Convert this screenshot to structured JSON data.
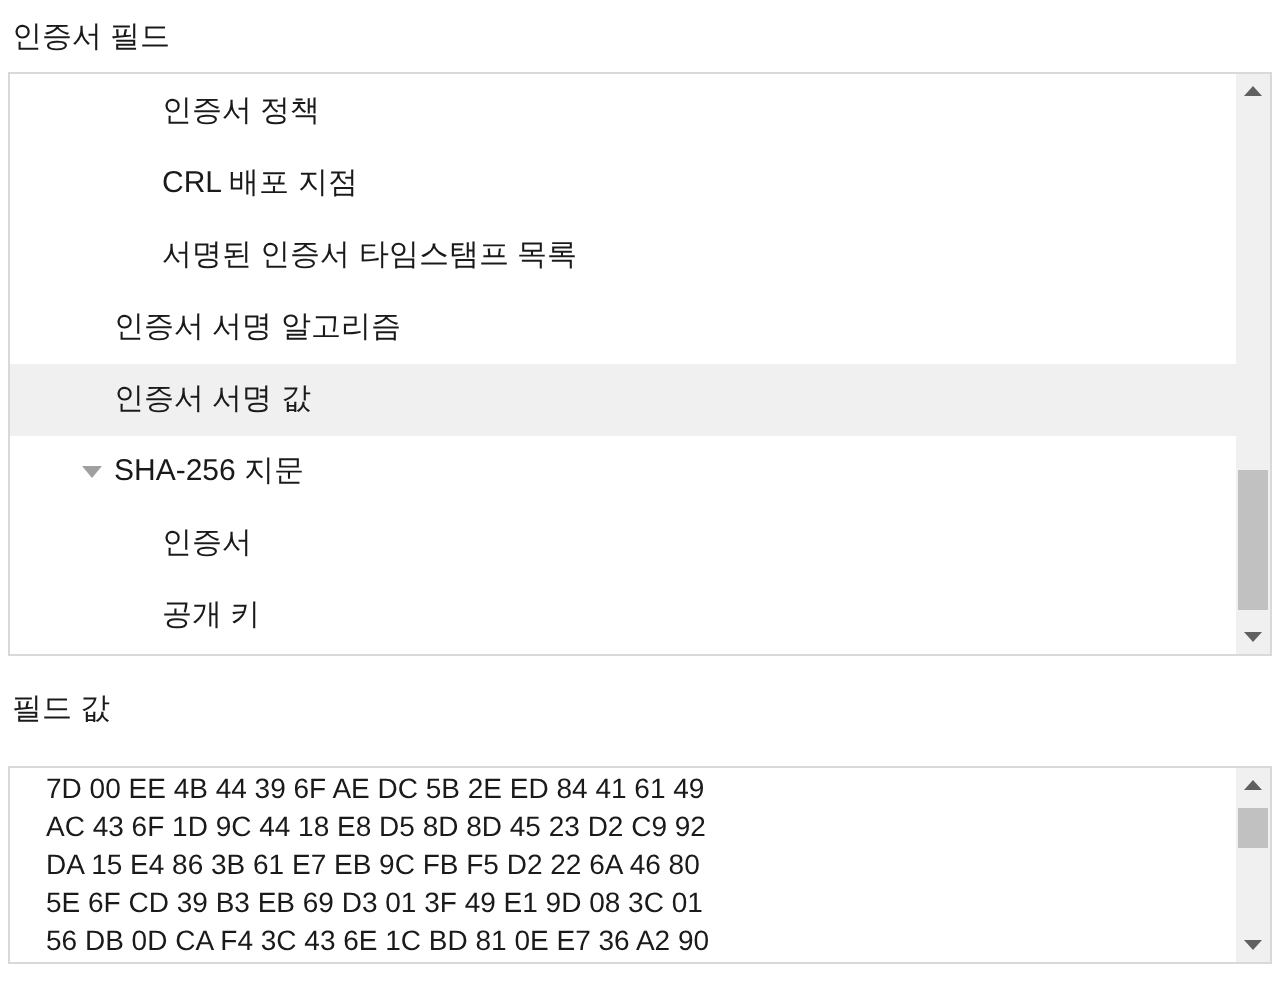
{
  "fields_heading": "인증서 필드",
  "tree": [
    {
      "children": [
        {
          "label": "인증서 정책",
          "selected": false
        },
        {
          "label": "CRL 배포 지점",
          "selected": false
        },
        {
          "label": "서명된 인증서 타임스탬프 목록",
          "selected": false
        }
      ]
    },
    {
      "label": "인증서 서명 알고리즘",
      "selected": false
    },
    {
      "label": "인증서 서명 값",
      "selected": true
    },
    {
      "label": "SHA-256 지문",
      "selected": false,
      "expanded": true,
      "children": [
        {
          "label": "인증서",
          "selected": false
        },
        {
          "label": "공개 키",
          "selected": false
        }
      ]
    }
  ],
  "value_heading": "필드 값",
  "value_lines": [
    "7D 00 EE 4B 44 39 6F AE DC 5B 2E ED 84 41 61 49",
    "AC 43 6F 1D 9C 44 18 E8 D5 8D 8D 45 23 D2 C9 92",
    "DA 15 E4 86 3B 61 E7 EB 9C FB F5 D2 22 6A 46 80",
    "5E 6F CD 39 B3 EB 69 D3 01 3F 49 E1 9D 08 3C 01",
    "56 DB 0D CA F4 3C 43 6E 1C BD 81 0E E7 36 A2 90"
  ]
}
